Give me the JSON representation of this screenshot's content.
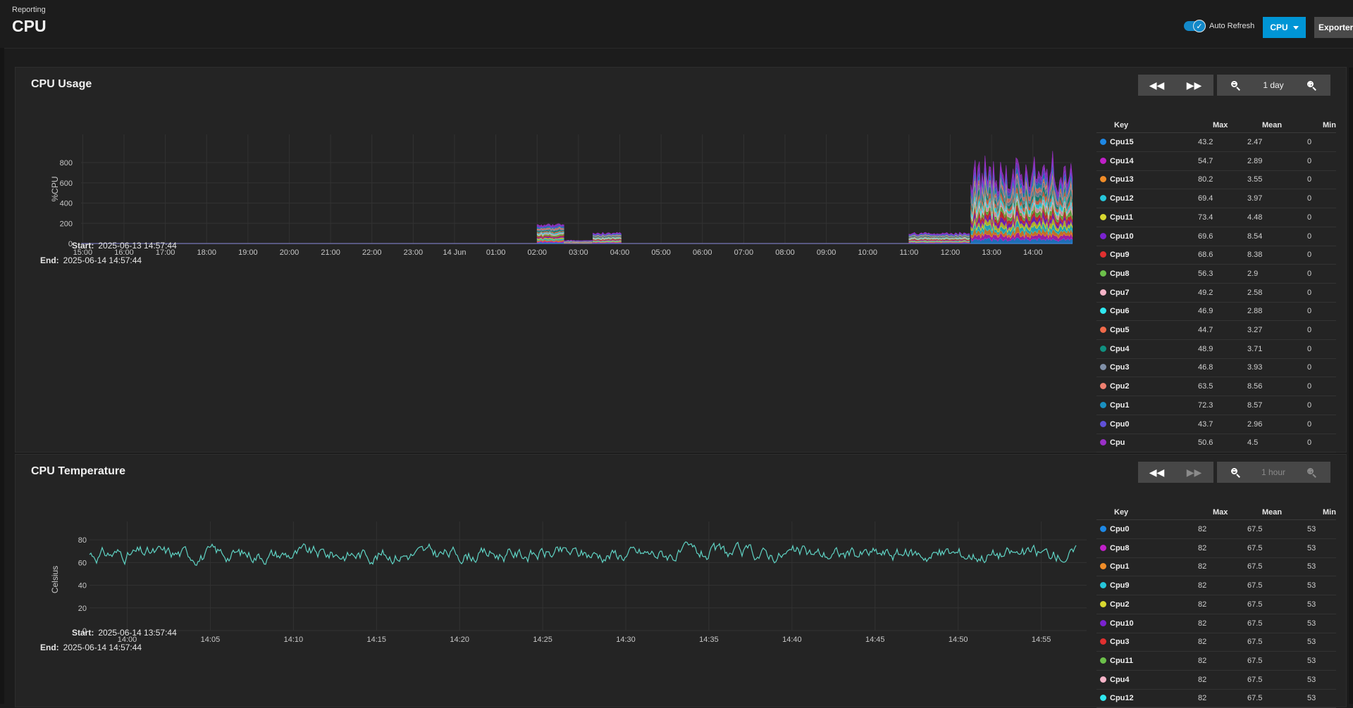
{
  "header": {
    "breadcrumb": "Reporting",
    "title": "CPU",
    "auto_refresh_label": "Auto Refresh",
    "auto_refresh_on": true,
    "cpu_button": "CPU",
    "exporters_button": "Exporters"
  },
  "usage": {
    "title": "CPU Usage",
    "zoom_label": "1 day",
    "start_label": "Start:",
    "start_value": "2025-06-13 14:57:44",
    "end_label": "End:",
    "end_value": "2025-06-14 14:57:44",
    "legend_headers": {
      "key": "Key",
      "max": "Max",
      "mean": "Mean",
      "min": "Min"
    },
    "legend": [
      {
        "name": "Cpu15",
        "max": "43.2",
        "mean": "2.47",
        "min": "0",
        "color": "#1e88e5"
      },
      {
        "name": "Cpu14",
        "max": "54.7",
        "mean": "2.89",
        "min": "0",
        "color": "#c020c8"
      },
      {
        "name": "Cpu13",
        "max": "80.2",
        "mean": "3.55",
        "min": "0",
        "color": "#f08c28"
      },
      {
        "name": "Cpu12",
        "max": "69.4",
        "mean": "3.97",
        "min": "0",
        "color": "#26c6da"
      },
      {
        "name": "Cpu11",
        "max": "73.4",
        "mean": "4.48",
        "min": "0",
        "color": "#d8d830"
      },
      {
        "name": "Cpu10",
        "max": "69.6",
        "mean": "8.54",
        "min": "0",
        "color": "#7a22d0"
      },
      {
        "name": "Cpu9",
        "max": "68.6",
        "mean": "8.38",
        "min": "0",
        "color": "#e03030"
      },
      {
        "name": "Cpu8",
        "max": "56.3",
        "mean": "2.9",
        "min": "0",
        "color": "#6cc04a"
      },
      {
        "name": "Cpu7",
        "max": "49.2",
        "mean": "2.58",
        "min": "0",
        "color": "#f6b4c8"
      },
      {
        "name": "Cpu6",
        "max": "46.9",
        "mean": "2.88",
        "min": "0",
        "color": "#30e8f0"
      },
      {
        "name": "Cpu5",
        "max": "44.7",
        "mean": "3.27",
        "min": "0",
        "color": "#f06a4a"
      },
      {
        "name": "Cpu4",
        "max": "48.9",
        "mean": "3.71",
        "min": "0",
        "color": "#109080"
      },
      {
        "name": "Cpu3",
        "max": "46.8",
        "mean": "3.93",
        "min": "0",
        "color": "#8090a8"
      },
      {
        "name": "Cpu2",
        "max": "63.5",
        "mean": "8.56",
        "min": "0",
        "color": "#f08070"
      },
      {
        "name": "Cpu1",
        "max": "72.3",
        "mean": "8.57",
        "min": "0",
        "color": "#1a90c0"
      },
      {
        "name": "Cpu0",
        "max": "43.7",
        "mean": "2.96",
        "min": "0",
        "color": "#6050d8"
      },
      {
        "name": "Cpu",
        "max": "50.6",
        "mean": "4.5",
        "min": "0",
        "color": "#9a30c8"
      }
    ]
  },
  "temp": {
    "title": "CPU Temperature",
    "zoom_label": "1 hour",
    "start_label": "Start:",
    "start_value": "2025-06-14 13:57:44",
    "end_label": "End:",
    "end_value": "2025-06-14 14:57:44",
    "legend_headers": {
      "key": "Key",
      "max": "Max",
      "mean": "Mean",
      "min": "Min"
    },
    "legend": [
      {
        "name": "Cpu0",
        "max": "82",
        "mean": "67.5",
        "min": "53",
        "color": "#1e88e5"
      },
      {
        "name": "Cpu8",
        "max": "82",
        "mean": "67.5",
        "min": "53",
        "color": "#c020c8"
      },
      {
        "name": "Cpu1",
        "max": "82",
        "mean": "67.5",
        "min": "53",
        "color": "#f08c28"
      },
      {
        "name": "Cpu9",
        "max": "82",
        "mean": "67.5",
        "min": "53",
        "color": "#26c6da"
      },
      {
        "name": "Cpu2",
        "max": "82",
        "mean": "67.5",
        "min": "53",
        "color": "#d8d830"
      },
      {
        "name": "Cpu10",
        "max": "82",
        "mean": "67.5",
        "min": "53",
        "color": "#7a22d0"
      },
      {
        "name": "Cpu3",
        "max": "82",
        "mean": "67.5",
        "min": "53",
        "color": "#e03030"
      },
      {
        "name": "Cpu11",
        "max": "82",
        "mean": "67.5",
        "min": "53",
        "color": "#6cc04a"
      },
      {
        "name": "Cpu4",
        "max": "82",
        "mean": "67.5",
        "min": "53",
        "color": "#f6b4c8"
      },
      {
        "name": "Cpu12",
        "max": "82",
        "mean": "67.5",
        "min": "53",
        "color": "#30e8f0"
      }
    ]
  },
  "chart_data": [
    {
      "type": "area",
      "title": "CPU Usage",
      "ylabel": "%CPU",
      "ylim": [
        0,
        800
      ],
      "yticks": [
        0,
        200,
        400,
        600,
        800
      ],
      "xticks": [
        "15:00",
        "16:00",
        "17:00",
        "18:00",
        "19:00",
        "20:00",
        "21:00",
        "22:00",
        "23:00",
        "14 Jun",
        "01:00",
        "02:00",
        "03:00",
        "04:00",
        "05:00",
        "06:00",
        "07:00",
        "08:00",
        "09:00",
        "10:00",
        "11:00",
        "12:00",
        "13:00",
        "14:00"
      ],
      "x_range_hours": [
        14.96,
        38.96
      ],
      "stacked": true,
      "series_count": 17,
      "segments": [
        {
          "from_hour": 26.0,
          "to_hour": 26.65,
          "total": 190
        },
        {
          "from_hour": 26.65,
          "to_hour": 27.35,
          "total": 30
        },
        {
          "from_hour": 27.35,
          "to_hour": 28.05,
          "total": 100
        },
        {
          "from_hour": 35.0,
          "to_hour": 36.5,
          "total": 100
        },
        {
          "from_hour": 36.5,
          "to_hour": 38.96,
          "total": 600
        }
      ],
      "grid": true
    },
    {
      "type": "line",
      "title": "CPU Temperature",
      "ylabel": "Celsius",
      "ylim": [
        0,
        90
      ],
      "yticks": [
        0,
        20,
        40,
        60,
        80
      ],
      "xticks": [
        "14:00",
        "14:05",
        "14:10",
        "14:15",
        "14:20",
        "14:25",
        "14:30",
        "14:35",
        "14:40",
        "14:45",
        "14:50",
        "14:55"
      ],
      "x_range_minutes": [
        57.73,
        117.73
      ],
      "series_summary": {
        "max": 82,
        "mean": 67.5,
        "min": 53
      },
      "line_color": "#5fd3c4",
      "grid": true
    }
  ]
}
